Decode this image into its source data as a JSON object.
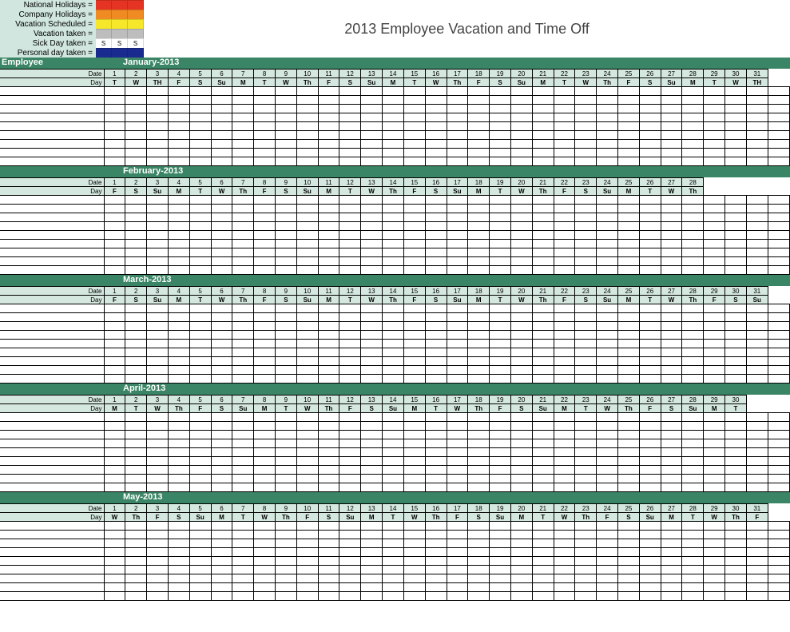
{
  "title": "2013 Employee Vacation and Time Off",
  "legend": {
    "items": [
      {
        "label": "National Holidays =",
        "colors": [
          "#e63424",
          "#e63424",
          "#e63424"
        ],
        "text": [
          "",
          "",
          ""
        ]
      },
      {
        "label": "Company Holidays =",
        "colors": [
          "#f08a22",
          "#f08a22",
          "#f08a22"
        ],
        "text": [
          "",
          "",
          ""
        ]
      },
      {
        "label": "Vacation Scheduled =",
        "colors": [
          "#f6e72a",
          "#f6e72a",
          "#f6e72a"
        ],
        "text": [
          "",
          "",
          ""
        ]
      },
      {
        "label": "Vacation taken =",
        "colors": [
          "#bdbdbd",
          "#bdbdbd",
          "#bdbdbd"
        ],
        "text": [
          "",
          "",
          ""
        ]
      },
      {
        "label": "Sick Day taken =",
        "colors": [
          "#ffffff",
          "#ffffff",
          "#ffffff"
        ],
        "text": [
          "S",
          "S",
          "S"
        ]
      },
      {
        "label": "Personal day taken =",
        "colors": [
          "#1a2b8f",
          "#1a2b8f",
          "#1a2b8f"
        ],
        "text": [
          "",
          "",
          ""
        ]
      }
    ]
  },
  "employee_header": "Employee",
  "row_labels": {
    "date": "Date",
    "day": "Day"
  },
  "months": [
    {
      "name": "January-2013",
      "show_employee": true,
      "days": [
        {
          "n": "1",
          "d": "T"
        },
        {
          "n": "2",
          "d": "W"
        },
        {
          "n": "3",
          "d": "TH"
        },
        {
          "n": "4",
          "d": "F"
        },
        {
          "n": "5",
          "d": "S"
        },
        {
          "n": "6",
          "d": "Su"
        },
        {
          "n": "7",
          "d": "M"
        },
        {
          "n": "8",
          "d": "T"
        },
        {
          "n": "9",
          "d": "W"
        },
        {
          "n": "10",
          "d": "Th"
        },
        {
          "n": "11",
          "d": "F"
        },
        {
          "n": "12",
          "d": "S"
        },
        {
          "n": "13",
          "d": "Su"
        },
        {
          "n": "14",
          "d": "M"
        },
        {
          "n": "15",
          "d": "T"
        },
        {
          "n": "16",
          "d": "W"
        },
        {
          "n": "17",
          "d": "Th"
        },
        {
          "n": "18",
          "d": "F"
        },
        {
          "n": "19",
          "d": "S"
        },
        {
          "n": "20",
          "d": "Su"
        },
        {
          "n": "21",
          "d": "M"
        },
        {
          "n": "22",
          "d": "T"
        },
        {
          "n": "23",
          "d": "W"
        },
        {
          "n": "24",
          "d": "Th"
        },
        {
          "n": "25",
          "d": "F"
        },
        {
          "n": "26",
          "d": "S"
        },
        {
          "n": "27",
          "d": "Su"
        },
        {
          "n": "28",
          "d": "M"
        },
        {
          "n": "29",
          "d": "T"
        },
        {
          "n": "30",
          "d": "W"
        },
        {
          "n": "31",
          "d": "TH"
        }
      ]
    },
    {
      "name": "February-2013",
      "show_employee": false,
      "days": [
        {
          "n": "1",
          "d": "F"
        },
        {
          "n": "2",
          "d": "S"
        },
        {
          "n": "3",
          "d": "Su"
        },
        {
          "n": "4",
          "d": "M"
        },
        {
          "n": "5",
          "d": "T"
        },
        {
          "n": "6",
          "d": "W"
        },
        {
          "n": "7",
          "d": "Th"
        },
        {
          "n": "8",
          "d": "F"
        },
        {
          "n": "9",
          "d": "S"
        },
        {
          "n": "10",
          "d": "Su"
        },
        {
          "n": "11",
          "d": "M"
        },
        {
          "n": "12",
          "d": "T"
        },
        {
          "n": "13",
          "d": "W"
        },
        {
          "n": "14",
          "d": "Th"
        },
        {
          "n": "15",
          "d": "F"
        },
        {
          "n": "16",
          "d": "S"
        },
        {
          "n": "17",
          "d": "Su"
        },
        {
          "n": "18",
          "d": "M"
        },
        {
          "n": "19",
          "d": "T"
        },
        {
          "n": "20",
          "d": "W"
        },
        {
          "n": "21",
          "d": "Th"
        },
        {
          "n": "22",
          "d": "F"
        },
        {
          "n": "23",
          "d": "S"
        },
        {
          "n": "24",
          "d": "Su"
        },
        {
          "n": "25",
          "d": "M"
        },
        {
          "n": "26",
          "d": "T"
        },
        {
          "n": "27",
          "d": "W"
        },
        {
          "n": "28",
          "d": "Th"
        }
      ]
    },
    {
      "name": "March-2013",
      "show_employee": false,
      "days": [
        {
          "n": "1",
          "d": "F"
        },
        {
          "n": "2",
          "d": "S"
        },
        {
          "n": "3",
          "d": "Su"
        },
        {
          "n": "4",
          "d": "M"
        },
        {
          "n": "5",
          "d": "T"
        },
        {
          "n": "6",
          "d": "W"
        },
        {
          "n": "7",
          "d": "Th"
        },
        {
          "n": "8",
          "d": "F"
        },
        {
          "n": "9",
          "d": "S"
        },
        {
          "n": "10",
          "d": "Su"
        },
        {
          "n": "11",
          "d": "M"
        },
        {
          "n": "12",
          "d": "T"
        },
        {
          "n": "13",
          "d": "W"
        },
        {
          "n": "14",
          "d": "Th"
        },
        {
          "n": "15",
          "d": "F"
        },
        {
          "n": "16",
          "d": "S"
        },
        {
          "n": "17",
          "d": "Su"
        },
        {
          "n": "18",
          "d": "M"
        },
        {
          "n": "19",
          "d": "T"
        },
        {
          "n": "20",
          "d": "W"
        },
        {
          "n": "21",
          "d": "Th"
        },
        {
          "n": "22",
          "d": "F"
        },
        {
          "n": "23",
          "d": "S"
        },
        {
          "n": "24",
          "d": "Su"
        },
        {
          "n": "25",
          "d": "M"
        },
        {
          "n": "26",
          "d": "T"
        },
        {
          "n": "27",
          "d": "W"
        },
        {
          "n": "28",
          "d": "Th"
        },
        {
          "n": "29",
          "d": "F"
        },
        {
          "n": "30",
          "d": "S"
        },
        {
          "n": "31",
          "d": "Su"
        }
      ]
    },
    {
      "name": "April-2013",
      "show_employee": false,
      "days": [
        {
          "n": "1",
          "d": "M"
        },
        {
          "n": "2",
          "d": "T"
        },
        {
          "n": "3",
          "d": "W"
        },
        {
          "n": "4",
          "d": "Th"
        },
        {
          "n": "5",
          "d": "F"
        },
        {
          "n": "6",
          "d": "S"
        },
        {
          "n": "7",
          "d": "Su"
        },
        {
          "n": "8",
          "d": "M"
        },
        {
          "n": "9",
          "d": "T"
        },
        {
          "n": "10",
          "d": "W"
        },
        {
          "n": "11",
          "d": "Th"
        },
        {
          "n": "12",
          "d": "F"
        },
        {
          "n": "13",
          "d": "S"
        },
        {
          "n": "14",
          "d": "Su"
        },
        {
          "n": "15",
          "d": "M"
        },
        {
          "n": "16",
          "d": "T"
        },
        {
          "n": "17",
          "d": "W"
        },
        {
          "n": "18",
          "d": "Th"
        },
        {
          "n": "19",
          "d": "F"
        },
        {
          "n": "20",
          "d": "S"
        },
        {
          "n": "21",
          "d": "Su"
        },
        {
          "n": "22",
          "d": "M"
        },
        {
          "n": "23",
          "d": "T"
        },
        {
          "n": "24",
          "d": "W"
        },
        {
          "n": "25",
          "d": "Th"
        },
        {
          "n": "26",
          "d": "F"
        },
        {
          "n": "27",
          "d": "S"
        },
        {
          "n": "28",
          "d": "Su"
        },
        {
          "n": "29",
          "d": "M"
        },
        {
          "n": "30",
          "d": "T"
        }
      ]
    },
    {
      "name": "May-2013",
      "show_employee": false,
      "days": [
        {
          "n": "1",
          "d": "W"
        },
        {
          "n": "2",
          "d": "Th"
        },
        {
          "n": "3",
          "d": "F"
        },
        {
          "n": "4",
          "d": "S"
        },
        {
          "n": "5",
          "d": "Su"
        },
        {
          "n": "6",
          "d": "M"
        },
        {
          "n": "7",
          "d": "T"
        },
        {
          "n": "8",
          "d": "W"
        },
        {
          "n": "9",
          "d": "Th"
        },
        {
          "n": "10",
          "d": "F"
        },
        {
          "n": "11",
          "d": "S"
        },
        {
          "n": "12",
          "d": "Su"
        },
        {
          "n": "13",
          "d": "M"
        },
        {
          "n": "14",
          "d": "T"
        },
        {
          "n": "15",
          "d": "W"
        },
        {
          "n": "16",
          "d": "Th"
        },
        {
          "n": "17",
          "d": "F"
        },
        {
          "n": "18",
          "d": "S"
        },
        {
          "n": "19",
          "d": "Su"
        },
        {
          "n": "20",
          "d": "M"
        },
        {
          "n": "21",
          "d": "T"
        },
        {
          "n": "22",
          "d": "W"
        },
        {
          "n": "23",
          "d": "Th"
        },
        {
          "n": "24",
          "d": "F"
        },
        {
          "n": "25",
          "d": "S"
        },
        {
          "n": "26",
          "d": "Su"
        },
        {
          "n": "27",
          "d": "M"
        },
        {
          "n": "28",
          "d": "T"
        },
        {
          "n": "29",
          "d": "W"
        },
        {
          "n": "30",
          "d": "Th"
        },
        {
          "n": "31",
          "d": "F"
        }
      ]
    }
  ],
  "body_rows_per_month": 9,
  "last_month_body_rows": 9,
  "total_day_cols": 31
}
